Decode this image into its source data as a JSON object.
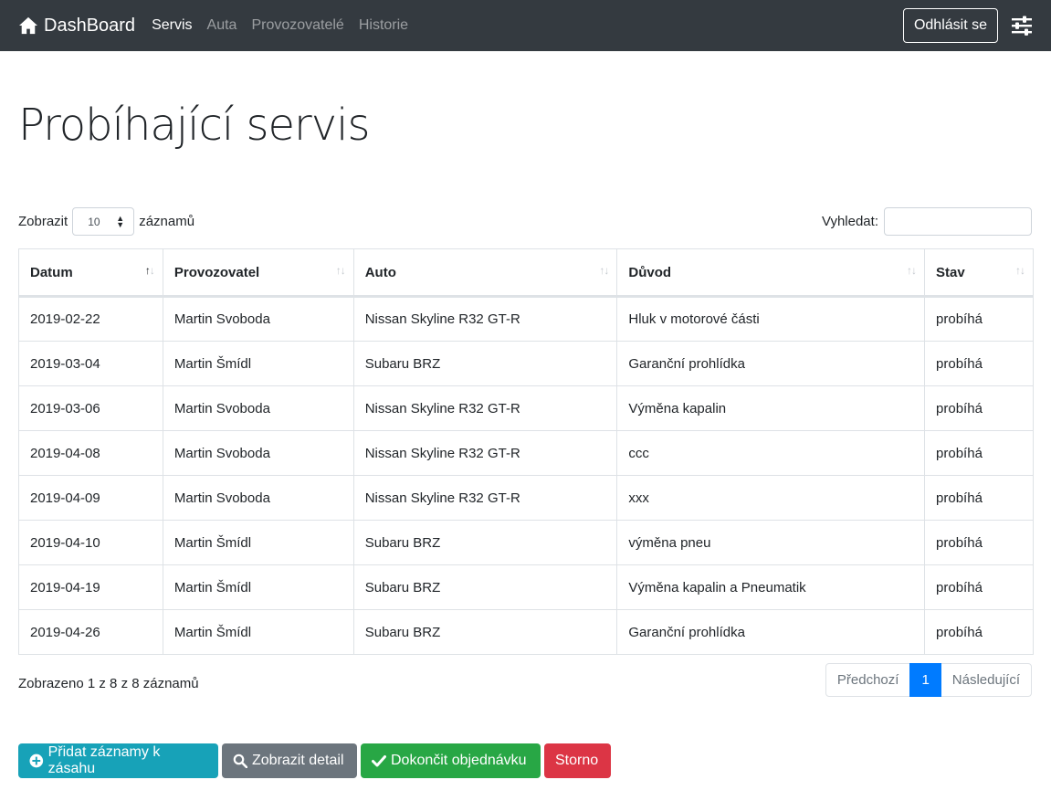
{
  "navbar": {
    "brand": "DashBoard",
    "links": [
      {
        "label": "Servis",
        "active": true
      },
      {
        "label": "Auta",
        "active": false
      },
      {
        "label": "Provozovatelé",
        "active": false
      },
      {
        "label": "Historie",
        "active": false
      }
    ],
    "logout_label": "Odhlásit se",
    "settings_icon": "sliders-icon",
    "home_icon": "home-icon"
  },
  "page": {
    "title": "Probíhající servis"
  },
  "table_controls": {
    "show_label": "Zobrazit",
    "page_length": "10",
    "records_label": "záznamů",
    "search_label": "Vyhledat:",
    "search_value": ""
  },
  "table": {
    "columns": [
      "Datum",
      "Provozovatel",
      "Auto",
      "Důvod",
      "Stav"
    ],
    "sorted_column": "Datum",
    "rows": [
      [
        "2019-02-22",
        "Martin Svoboda",
        "Nissan Skyline R32 GT-R",
        "Hluk v motorové části",
        "probíhá"
      ],
      [
        "2019-03-04",
        "Martin Šmídl",
        "Subaru BRZ",
        "Garanční prohlídka",
        "probíhá"
      ],
      [
        "2019-03-06",
        "Martin Svoboda",
        "Nissan Skyline R32 GT-R",
        "Výměna kapalin",
        "probíhá"
      ],
      [
        "2019-04-08",
        "Martin Svoboda",
        "Nissan Skyline R32 GT-R",
        "ccc",
        "probíhá"
      ],
      [
        "2019-04-09",
        "Martin Svoboda",
        "Nissan Skyline R32 GT-R",
        "xxx",
        "probíhá"
      ],
      [
        "2019-04-10",
        "Martin Šmídl",
        "Subaru BRZ",
        "výměna pneu",
        "probíhá"
      ],
      [
        "2019-04-19",
        "Martin Šmídl",
        "Subaru BRZ",
        "Výměna kapalin a Pneumatik",
        "probíhá"
      ],
      [
        "2019-04-26",
        "Martin Šmídl",
        "Subaru BRZ",
        "Garanční prohlídka",
        "probíhá"
      ]
    ]
  },
  "info": "Zobrazeno 1 z 8 z 8 záznamů",
  "pagination": {
    "prev": "Předchozí",
    "current": "1",
    "next": "Následující"
  },
  "actions": {
    "add_label": "Přidat záznamy k zásahu",
    "detail_label": "Zobrazit detail",
    "finish_label": "Dokončit objednávku",
    "cancel_label": "Storno"
  },
  "colors": {
    "navbar": "#343a40",
    "primary": "#007bff",
    "info": "#17a2b8",
    "secondary": "#6c757d",
    "success": "#28a745",
    "danger": "#dc3545"
  }
}
